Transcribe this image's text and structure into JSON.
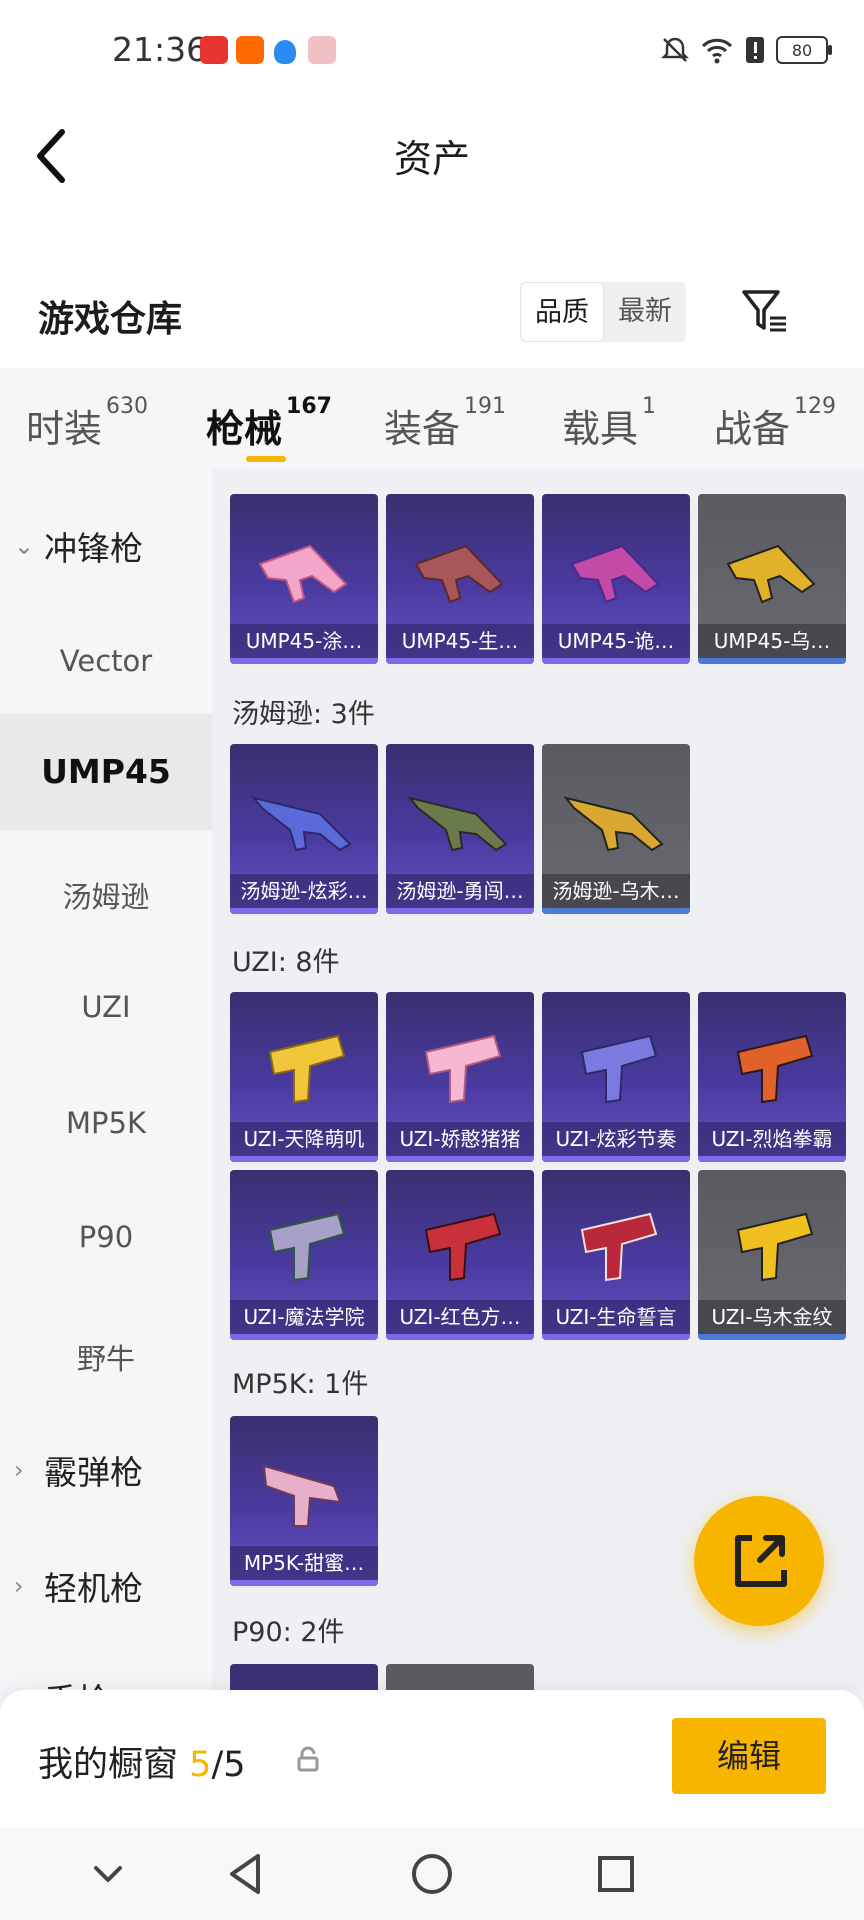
{
  "status_bar": {
    "time": "21:36",
    "battery": "80"
  },
  "header": {
    "title": "资产"
  },
  "warehouse": {
    "title": "游戏仓库",
    "sort_quality": "品质",
    "sort_newest": "最新"
  },
  "tabs": [
    {
      "label": "时装",
      "count": "630"
    },
    {
      "label": "枪械",
      "count": "167"
    },
    {
      "label": "装备",
      "count": "191"
    },
    {
      "label": "载具",
      "count": "1"
    },
    {
      "label": "战备",
      "count": "129"
    }
  ],
  "sidebar": {
    "group_smg": "冲锋枪",
    "items": [
      "Vector",
      "UMP45",
      "汤姆逊",
      "UZI",
      "MP5K",
      "P90",
      "野牛"
    ],
    "group_shotgun": "霰弹枪",
    "group_lmg": "轻机枪",
    "group_pistol": "手枪"
  },
  "sections": {
    "ump45_cards": [
      "UMP45-涂…",
      "UMP45-生…",
      "UMP45-诡…",
      "UMP45-乌…"
    ],
    "thompson_title": "汤姆逊: 3件",
    "thompson_cards": [
      "汤姆逊-炫彩…",
      "汤姆逊-勇闯…",
      "汤姆逊-乌木…"
    ],
    "uzi_title": "UZI: 8件",
    "uzi_cards": [
      "UZI-天降萌叽",
      "UZI-娇憨猪猪",
      "UZI-炫彩节奏",
      "UZI-烈焰拳霸",
      "UZI-魔法学院",
      "UZI-红色方…",
      "UZI-生命誓言",
      "UZI-乌木金纹"
    ],
    "mp5k_title": "MP5K: 1件",
    "mp5k_cards": [
      "MP5K-甜蜜…"
    ],
    "p90_title": "P90: 2件"
  },
  "bottom": {
    "showcase_label": "我的橱窗",
    "used": "5",
    "sep_total": "/5",
    "edit_label": "编辑"
  },
  "colors": {
    "accent": "#f7b500",
    "purple_card": "#4a3aa0",
    "gray_card": "#6a6a72"
  }
}
